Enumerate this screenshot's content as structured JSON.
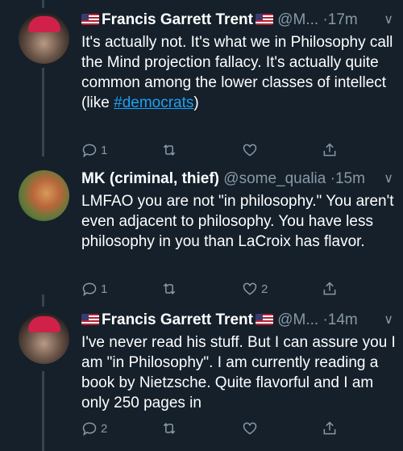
{
  "tweets": [
    {
      "name": "Francis Garrett Trent",
      "handle": "@M...",
      "dot": "·",
      "time": "17m",
      "text_before": "It's actually not. It's what we in Philosophy call the Mind projection fallacy. It's actually quite common among the lower classes of intellect (like ",
      "hashtag": "#democrats",
      "text_after": ")",
      "replies": "1",
      "retweets": "",
      "likes": ""
    },
    {
      "name": "MK (criminal, thief)",
      "handle": "@some_qualia",
      "dot": "·",
      "time": "15m",
      "text": "LMFAO you are not \"in philosophy.\" You aren't even adjacent to philosophy. You have less philosophy in you than LaCroix has flavor.",
      "replies": "1",
      "retweets": "",
      "likes": "2"
    },
    {
      "name": "Francis Garrett Trent",
      "handle": "@M...",
      "dot": "·",
      "time": "14m",
      "text": "I've never read his stuff. But I can assure you I am \"in Philosophy\". I am currently reading a book by Nietzsche. Quite flavorful and I am only 250 pages in",
      "replies": "2",
      "retweets": "",
      "likes": ""
    }
  ],
  "colors": {
    "background": "#15202b",
    "secondary_text": "#8899a6",
    "link": "#1da1f2",
    "thread_line": "#38444d"
  },
  "icons": [
    "reply-icon",
    "retweet-icon",
    "like-icon",
    "share-icon",
    "chevron-down-icon",
    "us-flag-icon"
  ]
}
